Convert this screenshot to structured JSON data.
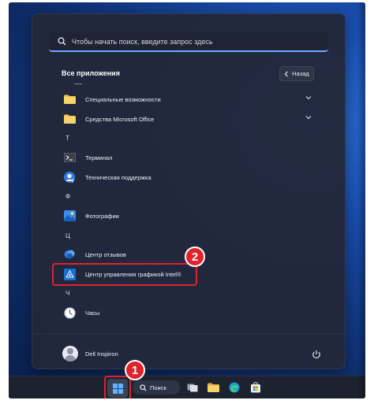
{
  "search": {
    "placeholder": "Чтобы начать поиск, введите запрос здесь"
  },
  "all_apps": {
    "title": "Все приложения",
    "back_label": "Назад"
  },
  "apps": {
    "accessibility": "Специальные возможности",
    "office_tools": "Средства Microsoft Office",
    "letter_t": "Т",
    "terminal": "Терминал",
    "support": "Техническая поддержка",
    "letter_f": "Ф",
    "photos": "Фотографии",
    "letter_ts": "Ц",
    "feedback": "Центр отзывов",
    "intel": "Центр управления графикой Intel®",
    "letter_ch": "Ч",
    "clock": "Часы"
  },
  "user": {
    "name": "Dell Inspiron"
  },
  "taskbar": {
    "search_label": "Поиск"
  },
  "annotations": {
    "badge_1": "1",
    "badge_2": "2"
  },
  "colors": {
    "accent": "#6ea9ff",
    "annotation_red": "#e0222b",
    "menu_bg": "#22283a"
  }
}
